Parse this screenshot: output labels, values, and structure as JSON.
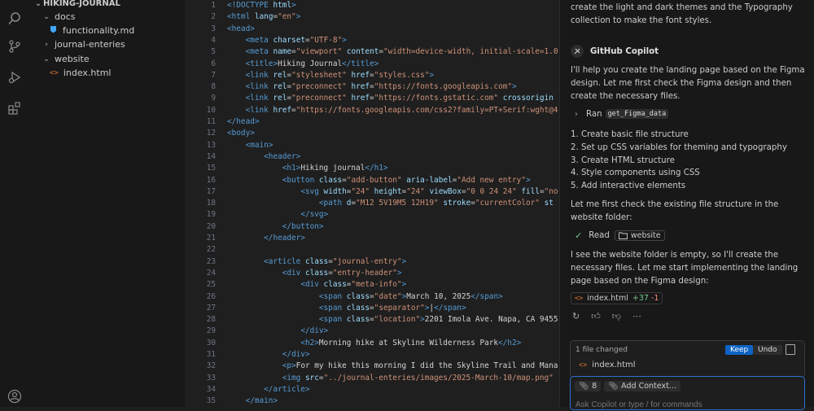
{
  "explorer": {
    "root": "HIKING-JOURNAL",
    "items": [
      {
        "label": "docs",
        "kind": "folder-open",
        "depth": 0
      },
      {
        "label": "functionality.md",
        "kind": "md",
        "depth": 1
      },
      {
        "label": "journal-enteries",
        "kind": "folder-closed",
        "depth": 0
      },
      {
        "label": "website",
        "kind": "folder-open",
        "depth": 0
      },
      {
        "label": "index.html",
        "kind": "html",
        "depth": 1
      }
    ]
  },
  "editor": {
    "lines": [
      {
        "n": "1",
        "html": "<span class='tg'>&lt;!DOCTYPE</span> <span class='at'>html</span><span class='tg'>&gt;</span>"
      },
      {
        "n": "2",
        "html": "<span class='tg'>&lt;html</span> <span class='at'>lang</span>=<span class='st'>\"en\"</span><span class='tg'>&gt;</span>"
      },
      {
        "n": "3",
        "html": "<span class='tg'>&lt;head&gt;</span>"
      },
      {
        "n": "4",
        "html": "    <span class='tg'>&lt;meta</span> <span class='at'>charset</span>=<span class='st'>\"UTF-8\"</span><span class='tg'>&gt;</span>"
      },
      {
        "n": "5",
        "html": "    <span class='tg'>&lt;meta</span> <span class='at'>name</span>=<span class='st'>\"viewport\"</span> <span class='at'>content</span>=<span class='st'>\"width=device-width, initial-scale=1.0\"</span>"
      },
      {
        "n": "6",
        "html": "    <span class='tg'>&lt;title&gt;</span><span class='tx'>Hiking Journal</span><span class='tg'>&lt;/title&gt;</span>"
      },
      {
        "n": "7",
        "html": "    <span class='tg'>&lt;link</span> <span class='at'>rel</span>=<span class='st'>\"stylesheet\"</span> <span class='at'>href</span>=<span class='st'>\"styles.css\"</span><span class='tg'>&gt;</span>"
      },
      {
        "n": "8",
        "html": "    <span class='tg'>&lt;link</span> <span class='at'>rel</span>=<span class='st'>\"preconnect\"</span> <span class='at'>href</span>=<span class='st'>\"https://fonts.googleapis.com\"</span><span class='tg'>&gt;</span>"
      },
      {
        "n": "9",
        "html": "    <span class='tg'>&lt;link</span> <span class='at'>rel</span>=<span class='st'>\"preconnect\"</span> <span class='at'>href</span>=<span class='st'>\"https://fonts.gstatic.com\"</span> <span class='at'>crossorigin</span>"
      },
      {
        "n": "10",
        "html": "    <span class='tg'>&lt;link</span> <span class='at'>href</span>=<span class='st'>\"https://fonts.googleapis.com/css2?family=PT+Serif:wght@4</span>"
      },
      {
        "n": "11",
        "html": "<span class='tg'>&lt;/head&gt;</span>"
      },
      {
        "n": "12",
        "html": "<span class='tg'>&lt;body&gt;</span>"
      },
      {
        "n": "13",
        "html": "    <span class='tg'>&lt;main&gt;</span>"
      },
      {
        "n": "14",
        "html": "        <span class='tg'>&lt;header&gt;</span>"
      },
      {
        "n": "15",
        "html": "            <span class='tg'>&lt;h1&gt;</span><span class='tx'>Hiking journal</span><span class='tg'>&lt;/h1&gt;</span>"
      },
      {
        "n": "16",
        "html": "            <span class='tg'>&lt;button</span> <span class='at'>class</span>=<span class='st'>\"add-button\"</span> <span class='at'>aria-label</span>=<span class='st'>\"Add new entry\"</span><span class='tg'>&gt;</span>"
      },
      {
        "n": "17",
        "html": "                <span class='tg'>&lt;svg</span> <span class='at'>width</span>=<span class='st'>\"24\"</span> <span class='at'>height</span>=<span class='st'>\"24\"</span> <span class='at'>viewBox</span>=<span class='st'>\"0 0 24 24\"</span> <span class='at'>fill</span>=<span class='st'>\"no</span>"
      },
      {
        "n": "18",
        "html": "                    <span class='tg'>&lt;path</span> <span class='at'>d</span>=<span class='st'>\"M12 5V19M5 12H19\"</span> <span class='at'>stroke</span>=<span class='st'>\"currentColor\"</span> <span class='at'>st</span>"
      },
      {
        "n": "19",
        "html": "                <span class='tg'>&lt;/svg&gt;</span>"
      },
      {
        "n": "20",
        "html": "            <span class='tg'>&lt;/button&gt;</span>"
      },
      {
        "n": "21",
        "html": "        <span class='tg'>&lt;/header&gt;</span>"
      },
      {
        "n": "22",
        "html": ""
      },
      {
        "n": "23",
        "html": "        <span class='tg'>&lt;article</span> <span class='at'>class</span>=<span class='st'>\"journal-entry\"</span><span class='tg'>&gt;</span>"
      },
      {
        "n": "24",
        "html": "            <span class='tg'>&lt;div</span> <span class='at'>class</span>=<span class='st'>\"entry-header\"</span><span class='tg'>&gt;</span>"
      },
      {
        "n": "25",
        "html": "                <span class='tg'>&lt;div</span> <span class='at'>class</span>=<span class='st'>\"meta-info\"</span><span class='tg'>&gt;</span>"
      },
      {
        "n": "26",
        "html": "                    <span class='tg'>&lt;span</span> <span class='at'>class</span>=<span class='st'>\"date\"</span><span class='tg'>&gt;</span><span class='tx'>March 10, 2025</span><span class='tg'>&lt;/span&gt;</span>"
      },
      {
        "n": "27",
        "html": "                    <span class='tg'>&lt;span</span> <span class='at'>class</span>=<span class='st'>\"separator\"</span><span class='tg'>&gt;</span><span class='tx'>|</span><span class='tg'>&lt;/span&gt;</span>"
      },
      {
        "n": "28",
        "html": "                    <span class='tg'>&lt;span</span> <span class='at'>class</span>=<span class='st'>\"location\"</span><span class='tg'>&gt;</span><span class='tx'>2201 Imola Ave. Napa, CA 9455</span>"
      },
      {
        "n": "29",
        "html": "                <span class='tg'>&lt;/div&gt;</span>"
      },
      {
        "n": "30",
        "html": "                <span class='tg'>&lt;h2&gt;</span><span class='tx'>Morning hike at Skyline Wilderness Park</span><span class='tg'>&lt;/h2&gt;</span>"
      },
      {
        "n": "31",
        "html": "            <span class='tg'>&lt;/div&gt;</span>"
      },
      {
        "n": "32",
        "html": "            <span class='tg'>&lt;p&gt;</span><span class='tx'>For my hike this morning I did the Skyline Trail and Mana</span>"
      },
      {
        "n": "33",
        "html": "            <span class='tg'>&lt;img</span> <span class='at'>src</span>=<span class='st'>\"../journal-enteries/images/2025-March-10/map.png\"</span>"
      },
      {
        "n": "34",
        "html": "        <span class='tg'>&lt;/article&gt;</span>"
      },
      {
        "n": "35",
        "html": "    <span class='tg'>&lt;/main&gt;</span>"
      }
    ]
  },
  "chat": {
    "intro_text": "create the light and dark themes and the Typography collection to make the font styles.",
    "assistant_name": "GitHub Copilot",
    "reply_1": "I'll help you create the landing page based on the Figma design. Let me first check the Figma design and then create the necessary files.",
    "ran_label": "Ran",
    "ran_tool": "get_Figma_data",
    "steps": [
      "1. Create basic file structure",
      "2. Set up CSS variables for theming and typography",
      "3. Create HTML structure",
      "4. Style components using CSS",
      "5. Add interactive elements"
    ],
    "reply_2": "Let me first check the existing file structure in the website folder:",
    "read_label": "Read",
    "read_target": "website",
    "reply_3": "I see the website folder is empty, so I'll create the necessary files. Let me start implementing the landing page based on the Figma design:",
    "file_chip": {
      "name": "index.html",
      "added": "+37",
      "removed": "-1"
    },
    "changes": {
      "count_label": "1 file changed",
      "keep": "Keep",
      "undo": "Undo",
      "file": "index.html"
    },
    "input": {
      "attach_count": "8",
      "add_context": "Add Context...",
      "placeholder": "Ask Copilot or type / for commands"
    }
  },
  "colors": {
    "accent": "#0e63c4",
    "added": "#73c991",
    "removed": "#f48771",
    "html_icon": "#e37933",
    "md_icon": "#42a5f5"
  }
}
